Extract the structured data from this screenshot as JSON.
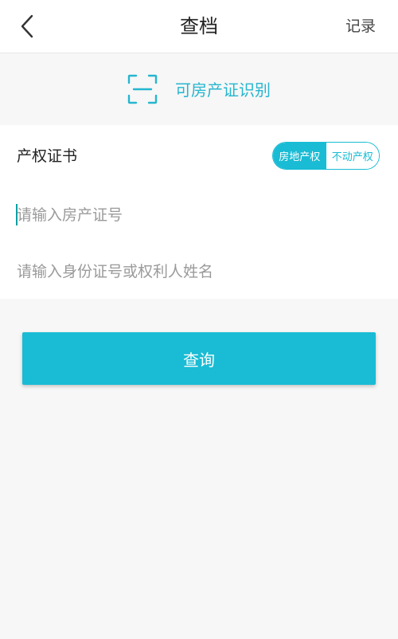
{
  "navbar": {
    "title": "查档",
    "record_label": "记录",
    "back_icon": "chevron-left-icon"
  },
  "scan": {
    "label": "可房产证识别",
    "icon": "scan-frame-icon"
  },
  "form": {
    "type_label": "产权证书",
    "segments": [
      {
        "label": "房地产权",
        "active": true
      },
      {
        "label": "不动产权",
        "active": false
      }
    ],
    "cert_placeholder": "请输入房产证号",
    "cert_value": "",
    "id_placeholder": "请输入身份证号或权利人姓名",
    "id_value": ""
  },
  "actions": {
    "query_label": "查询"
  },
  "colors": {
    "accent": "#19bcd4",
    "background": "#f7f7f7",
    "card": "#ffffff"
  }
}
